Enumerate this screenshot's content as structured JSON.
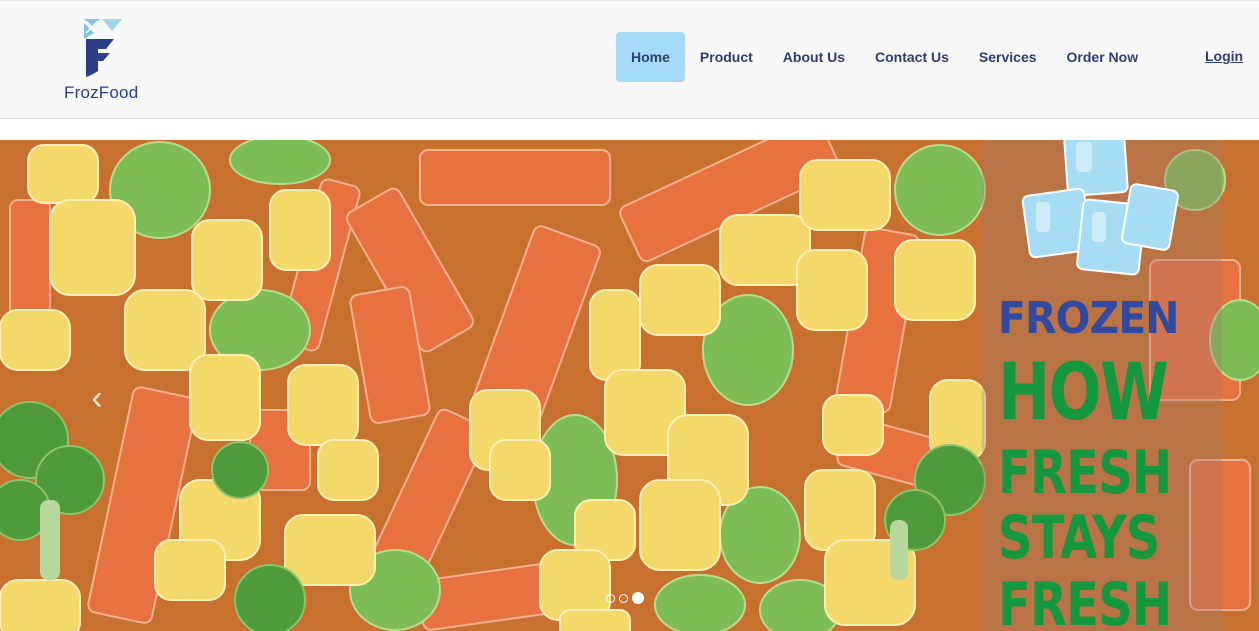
{
  "brand": {
    "name": "FrozFood",
    "logo_icon": "frozfood-logo-icon",
    "logo_color": "#2b3f8a",
    "logo_accent_color": "#7fc4ea"
  },
  "nav": {
    "items": [
      {
        "label": "Home",
        "active": true
      },
      {
        "label": "Product",
        "active": false
      },
      {
        "label": "About Us",
        "active": false
      },
      {
        "label": "Contact Us",
        "active": false
      },
      {
        "label": "Services",
        "active": false
      },
      {
        "label": "Order Now",
        "active": false
      }
    ],
    "login_label": "Login",
    "active_bg_color": "#a6dbf7",
    "text_color": "#2e3d72"
  },
  "hero": {
    "image_icon": "frozen-vegetables-image",
    "headline": {
      "line1": "FROZEN",
      "line2": "HOW",
      "line3": "FRESH",
      "line4": "STAYS",
      "line5": "FRESH"
    },
    "headline_colors": {
      "frozen": "#2f4a9e",
      "rest": "#15973f"
    },
    "prev_icon": "chevron-left-icon",
    "slide_count": 3,
    "active_slide": 3
  }
}
